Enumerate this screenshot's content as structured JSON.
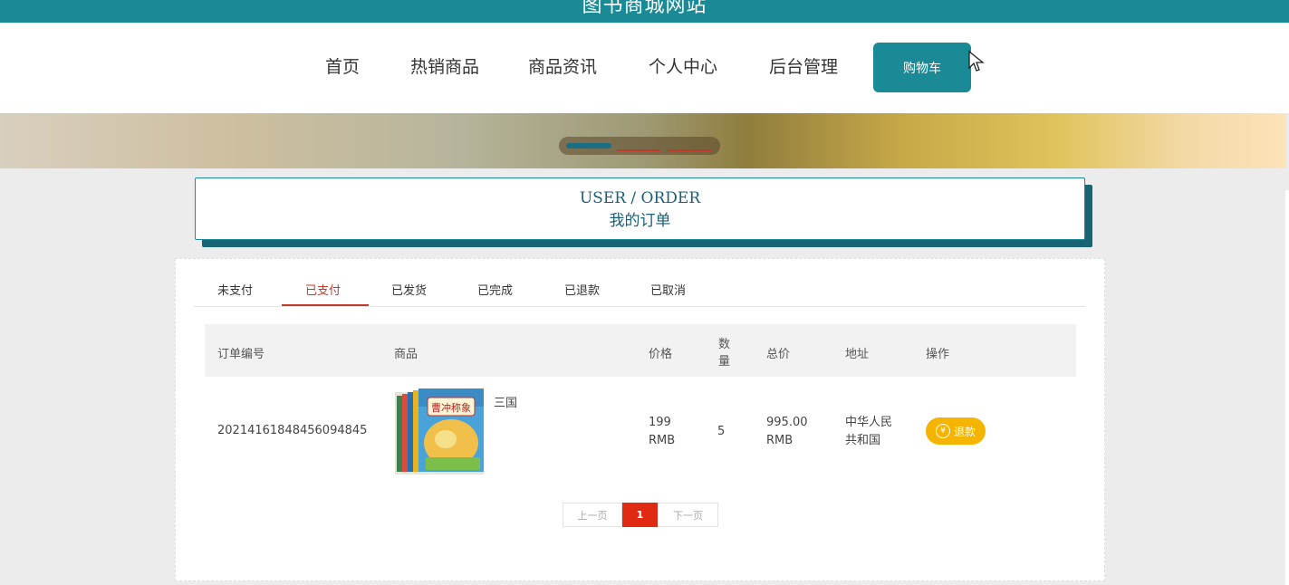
{
  "site": {
    "title": "图书商城网站"
  },
  "nav": {
    "items": [
      "首页",
      "热销商品",
      "商品资讯",
      "个人中心",
      "后台管理"
    ],
    "cart_label": "购物车"
  },
  "header": {
    "en_title": "USER / ORDER",
    "cn_title": "我的订单"
  },
  "tabs": {
    "items": [
      "未支付",
      "已支付",
      "已发货",
      "已完成",
      "已退款",
      "已取消"
    ],
    "active": "已支付"
  },
  "table": {
    "headers": {
      "order_no": "订单编号",
      "product": "商品",
      "price": "价格",
      "qty_line1": "数",
      "qty_line2": "量",
      "total": "总价",
      "address": "地址",
      "action": "操作"
    },
    "rows": [
      {
        "order_no": "20214161848456094845",
        "product_name": "三国",
        "cover_text": "曹冲称象",
        "price_value": "199",
        "price_unit": "RMB",
        "qty": "5",
        "total_value": "995.00",
        "total_unit": "RMB",
        "address_line1": "中华人民",
        "address_line2": "共和国",
        "action_label": "退款",
        "action_icon": "yen-circle-icon"
      }
    ]
  },
  "pagination": {
    "prev": "上一页",
    "current": "1",
    "next": "下一页"
  },
  "colors": {
    "primary": "#1a8a96",
    "active_tab": "#c0392b",
    "refund": "#f5b400",
    "page_current": "#e02a12"
  }
}
